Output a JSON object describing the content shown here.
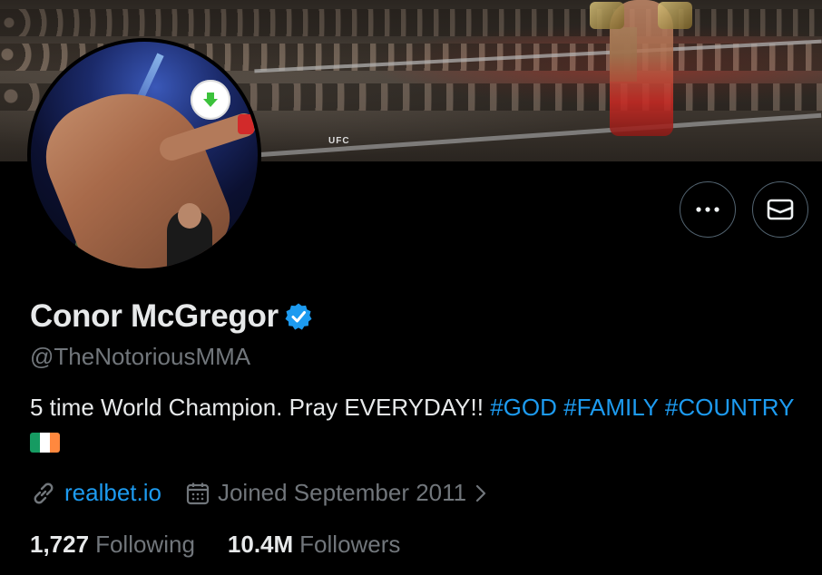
{
  "banner": {
    "ring_brand": "UFC"
  },
  "profile": {
    "name": "Conor McGregor",
    "handle": "@TheNotoriousMMA",
    "verified": true,
    "bio_text": "5 time World Champion. Pray EVERYDAY!!",
    "bio_hashtags": [
      "#GOD",
      "#FAMILY",
      "#COUNTRY"
    ],
    "bio_flag": "Ireland flag emoji",
    "website": "realbet.io",
    "joined": "Joined September 2011",
    "following_count": "1,727",
    "following_label": "Following",
    "followers_count": "10.4M",
    "followers_label": "Followers"
  },
  "actions": {
    "more_icon": "more-dots-icon",
    "message_icon": "mail-icon"
  },
  "colors": {
    "background": "#000000",
    "accent": "#1d9bf0",
    "secondary_text": "#71767b",
    "primary_text": "#e7e9ea",
    "button_border": "#536471",
    "flag_green": "#169b62",
    "flag_white": "#ffffff",
    "flag_orange": "#ff883e"
  }
}
